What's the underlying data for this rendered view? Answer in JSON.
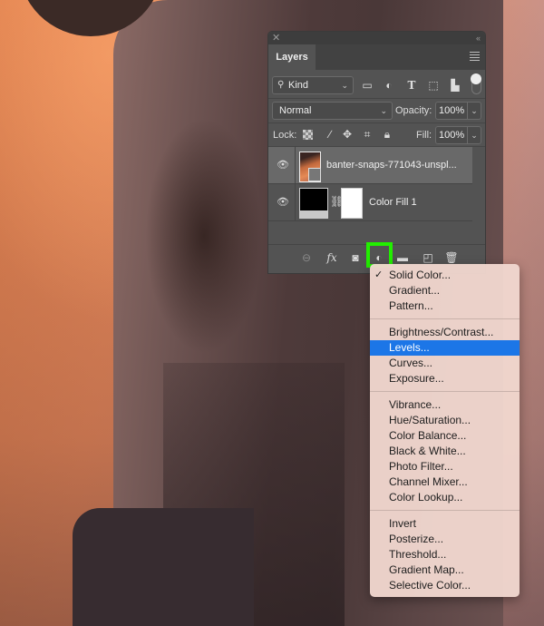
{
  "panel": {
    "close_icon": "close-x-icon",
    "collapse_icon": "double-chevron-icon",
    "tab_title": "Layers",
    "menu_icon": "hamburger-icon",
    "filter": {
      "kind_label": "Kind",
      "kind_icon": "search-icon",
      "filter_icons": [
        "image-filter-icon",
        "adjustment-filter-icon",
        "type-filter-icon",
        "shape-filter-icon",
        "smart-object-filter-icon"
      ],
      "toggle_icon": "filter-toggle-icon"
    },
    "blend_mode": "Normal",
    "opacity_label": "Opacity:",
    "opacity_value": "100%",
    "lock_label": "Lock:",
    "lock_icons": [
      "lock-transparent-icon",
      "lock-image-icon",
      "lock-position-icon",
      "lock-artboard-icon",
      "lock-all-icon"
    ],
    "fill_label": "Fill:",
    "fill_value": "100%",
    "layers": [
      {
        "name": "banter-snaps-771043-unspl...",
        "type": "smart-object",
        "visible": true,
        "selected": true
      },
      {
        "name": "Color Fill 1",
        "type": "fill-layer",
        "visible": true,
        "selected": false
      }
    ],
    "bottom_icons": [
      "link-layers-icon",
      "fx-icon",
      "add-mask-icon",
      "adjustment-layer-icon",
      "new-group-icon",
      "new-layer-icon",
      "trash-icon"
    ],
    "highlight_color": "#22ee00"
  },
  "menu": {
    "groups": [
      [
        {
          "label": "Solid Color...",
          "checked": true
        },
        {
          "label": "Gradient..."
        },
        {
          "label": "Pattern..."
        }
      ],
      [
        {
          "label": "Brightness/Contrast..."
        },
        {
          "label": "Levels...",
          "highlighted": true
        },
        {
          "label": "Curves..."
        },
        {
          "label": "Exposure..."
        }
      ],
      [
        {
          "label": "Vibrance..."
        },
        {
          "label": "Hue/Saturation..."
        },
        {
          "label": "Color Balance..."
        },
        {
          "label": "Black & White..."
        },
        {
          "label": "Photo Filter..."
        },
        {
          "label": "Channel Mixer..."
        },
        {
          "label": "Color Lookup..."
        }
      ],
      [
        {
          "label": "Invert"
        },
        {
          "label": "Posterize..."
        },
        {
          "label": "Threshold..."
        },
        {
          "label": "Gradient Map..."
        },
        {
          "label": "Selective Color..."
        }
      ]
    ],
    "check_glyph": "✓",
    "highlight_color": "#1c76e7"
  }
}
